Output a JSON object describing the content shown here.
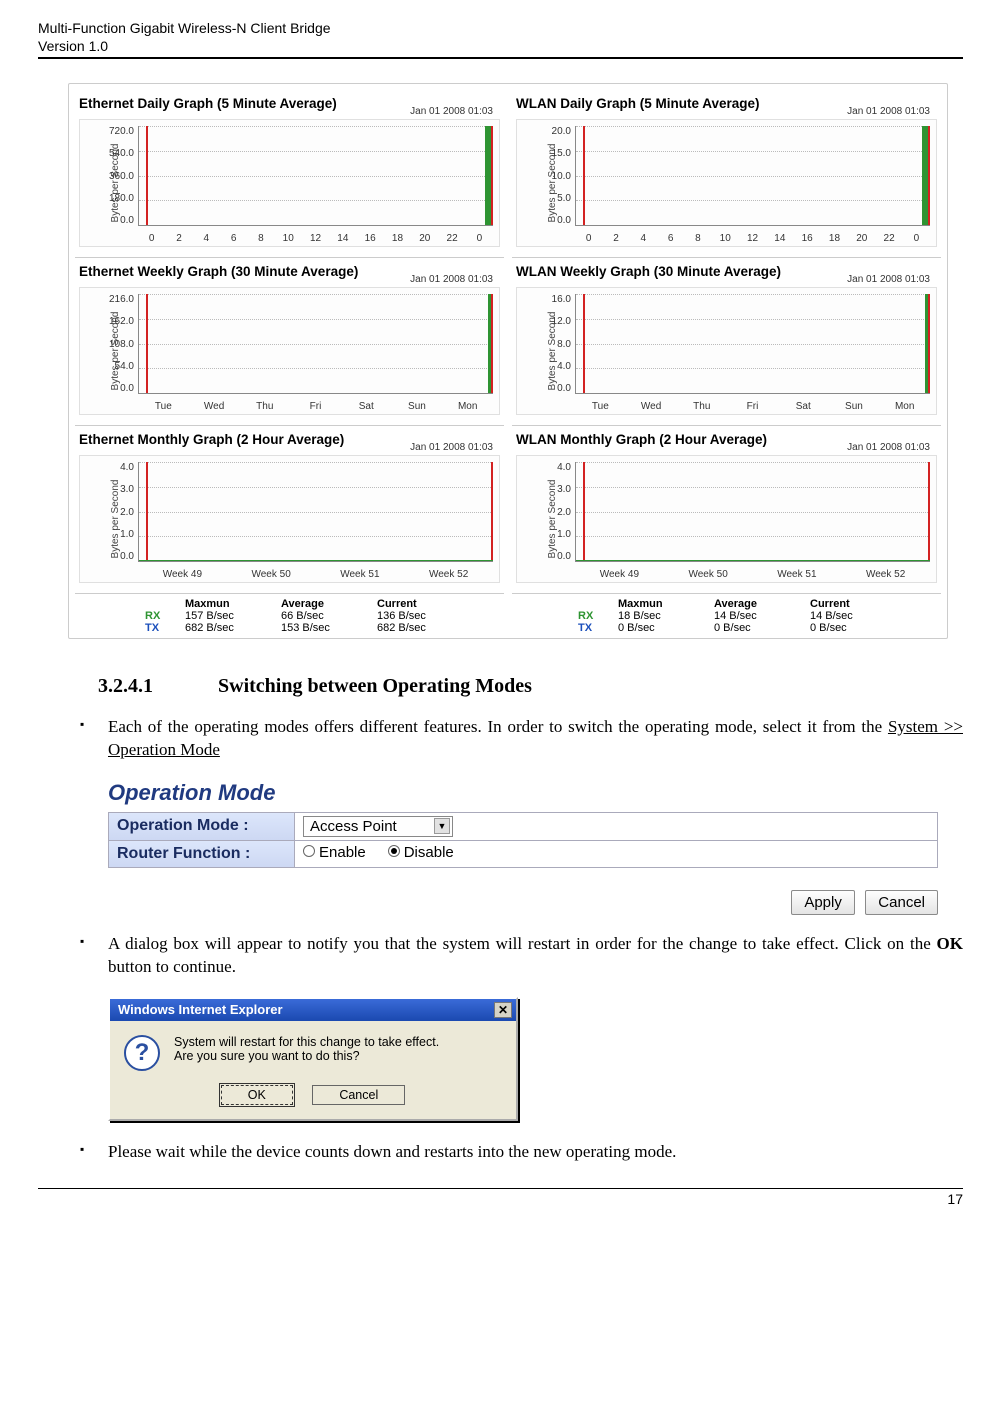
{
  "doc": {
    "title_line1": "Multi-Function Gigabit Wireless-N Client Bridge",
    "title_line2": "Version 1.0",
    "page_number": "17"
  },
  "section": {
    "number": "3.2.4.1",
    "title": "Switching between Operating Modes"
  },
  "bullets": {
    "b1_pre": "Each of the operating modes offers different features. In order to switch the operating mode, select it from the ",
    "b1_link": "System >> Operation Mode",
    "b2_pre": "A dialog box will appear to notify you that the system will restart in order for the change to take effect. Click on the ",
    "b2_bold": "OK",
    "b2_post": " button to continue.",
    "b3": "Please wait while the device counts down and restarts into the new operating mode."
  },
  "opmode": {
    "panel_title": "Operation Mode",
    "row1_label": "Operation Mode :",
    "row1_value": "Access Point",
    "row2_label": "Router Function :",
    "row2_opt1": "Enable",
    "row2_opt2": "Disable",
    "apply": "Apply",
    "cancel": "Cancel"
  },
  "iedialog": {
    "title": "Windows Internet Explorer",
    "line1": "System will restart for this change to take effect.",
    "line2": "Are you sure you want to do this?",
    "ok": "OK",
    "cancel": "Cancel"
  },
  "charts_common": {
    "timestamp": "Jan 01 2008 01:03",
    "ylabel": "Bytes per Second"
  },
  "stats": {
    "hdr_max": "Maxmun",
    "hdr_avg": "Average",
    "hdr_cur": "Current",
    "rx_label": "RX",
    "tx_label": "TX",
    "eth": {
      "rx": {
        "max": "157 B/sec",
        "avg": "66 B/sec",
        "cur": "136 B/sec"
      },
      "tx": {
        "max": "682 B/sec",
        "avg": "153 B/sec",
        "cur": "682 B/sec"
      }
    },
    "wlan": {
      "rx": {
        "max": "18 B/sec",
        "avg": "14 B/sec",
        "cur": "14 B/sec"
      },
      "tx": {
        "max": "0 B/sec",
        "avg": "0 B/sec",
        "cur": "0 B/sec"
      }
    }
  },
  "chart_data": [
    {
      "id": "eth_daily",
      "title": "Ethernet Daily Graph (5 Minute Average)",
      "type": "line",
      "xlabel": "",
      "ylabel": "Bytes per Second",
      "x_ticks": [
        "0",
        "2",
        "4",
        "6",
        "8",
        "10",
        "12",
        "14",
        "16",
        "18",
        "20",
        "22",
        "0"
      ],
      "y_ticks": [
        "720.0",
        "540.0",
        "360.0",
        "180.0",
        "0.0"
      ],
      "ylim": [
        0,
        720
      ],
      "timestamp": "Jan 01 2008 01:03",
      "series": [
        {
          "name": "RX",
          "color": "#2e9432",
          "note": "spike at right edge to ~720"
        },
        {
          "name": "TX",
          "color": "#1b4fbb",
          "note": "near zero"
        }
      ]
    },
    {
      "id": "wlan_daily",
      "title": "WLAN Daily Graph (5 Minute Average)",
      "type": "line",
      "xlabel": "",
      "ylabel": "Bytes per Second",
      "x_ticks": [
        "0",
        "2",
        "4",
        "6",
        "8",
        "10",
        "12",
        "14",
        "16",
        "18",
        "20",
        "22",
        "0"
      ],
      "y_ticks": [
        "20.0",
        "15.0",
        "10.0",
        "5.0",
        "0.0"
      ],
      "ylim": [
        0,
        20
      ],
      "timestamp": "Jan 01 2008 01:03",
      "series": [
        {
          "name": "RX",
          "color": "#2e9432",
          "note": "spike at right edge to ~20"
        },
        {
          "name": "TX",
          "color": "#1b4fbb",
          "note": "near zero"
        }
      ]
    },
    {
      "id": "eth_weekly",
      "title": "Ethernet Weekly Graph (30 Minute Average)",
      "type": "line",
      "xlabel": "",
      "ylabel": "Bytes per Second",
      "x_ticks": [
        "Tue",
        "Wed",
        "Thu",
        "Fri",
        "Sat",
        "Sun",
        "Mon"
      ],
      "y_ticks": [
        "216.0",
        "162.0",
        "108.0",
        "54.0",
        "0.0"
      ],
      "ylim": [
        0,
        216
      ],
      "timestamp": "Jan 01 2008 01:03",
      "series": [
        {
          "name": "RX",
          "color": "#2e9432",
          "note": "spike at right edge"
        },
        {
          "name": "TX",
          "color": "#1b4fbb",
          "note": "near zero"
        }
      ]
    },
    {
      "id": "wlan_weekly",
      "title": "WLAN Weekly Graph (30 Minute Average)",
      "type": "line",
      "xlabel": "",
      "ylabel": "Bytes per Second",
      "x_ticks": [
        "Tue",
        "Wed",
        "Thu",
        "Fri",
        "Sat",
        "Sun",
        "Mon"
      ],
      "y_ticks": [
        "16.0",
        "12.0",
        "8.0",
        "4.0",
        "0.0"
      ],
      "ylim": [
        0,
        16
      ],
      "timestamp": "Jan 01 2008 01:03",
      "series": [
        {
          "name": "RX",
          "color": "#2e9432",
          "note": "spike at right edge"
        },
        {
          "name": "TX",
          "color": "#1b4fbb",
          "note": "near zero"
        }
      ]
    },
    {
      "id": "eth_monthly",
      "title": "Ethernet Monthly Graph (2 Hour Average)",
      "type": "line",
      "xlabel": "",
      "ylabel": "Bytes per Second",
      "x_ticks": [
        "Week 49",
        "Week 50",
        "Week 51",
        "Week 52"
      ],
      "y_ticks": [
        "4.0",
        "3.0",
        "2.0",
        "1.0",
        "0.0"
      ],
      "ylim": [
        0,
        4
      ],
      "timestamp": "Jan 01 2008 01:03",
      "series": [
        {
          "name": "RX",
          "color": "#2e9432",
          "note": "flat zero"
        },
        {
          "name": "TX",
          "color": "#1b4fbb",
          "note": "flat zero"
        }
      ]
    },
    {
      "id": "wlan_monthly",
      "title": "WLAN Monthly Graph (2 Hour Average)",
      "type": "line",
      "xlabel": "",
      "ylabel": "Bytes per Second",
      "x_ticks": [
        "Week 49",
        "Week 50",
        "Week 51",
        "Week 52"
      ],
      "y_ticks": [
        "4.0",
        "3.0",
        "2.0",
        "1.0",
        "0.0"
      ],
      "ylim": [
        0,
        4
      ],
      "timestamp": "Jan 01 2008 01:03",
      "series": [
        {
          "name": "RX",
          "color": "#2e9432",
          "note": "flat zero"
        },
        {
          "name": "TX",
          "color": "#1b4fbb",
          "note": "flat zero"
        }
      ]
    }
  ]
}
